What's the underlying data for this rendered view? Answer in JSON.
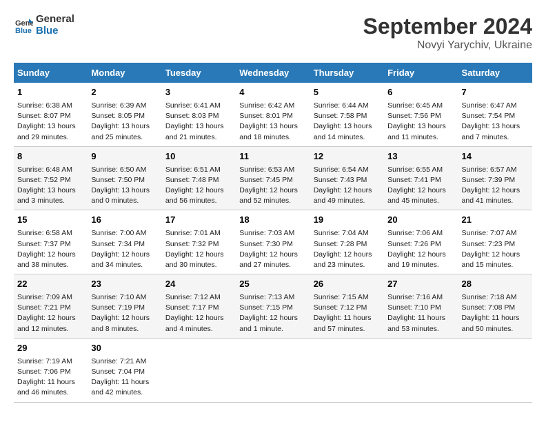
{
  "header": {
    "logo_line1": "General",
    "logo_line2": "Blue",
    "month": "September 2024",
    "location": "Novyi Yarychiv, Ukraine"
  },
  "days_of_week": [
    "Sunday",
    "Monday",
    "Tuesday",
    "Wednesday",
    "Thursday",
    "Friday",
    "Saturday"
  ],
  "weeks": [
    [
      {
        "day": "1",
        "info": "Sunrise: 6:38 AM\nSunset: 8:07 PM\nDaylight: 13 hours\nand 29 minutes."
      },
      {
        "day": "2",
        "info": "Sunrise: 6:39 AM\nSunset: 8:05 PM\nDaylight: 13 hours\nand 25 minutes."
      },
      {
        "day": "3",
        "info": "Sunrise: 6:41 AM\nSunset: 8:03 PM\nDaylight: 13 hours\nand 21 minutes."
      },
      {
        "day": "4",
        "info": "Sunrise: 6:42 AM\nSunset: 8:01 PM\nDaylight: 13 hours\nand 18 minutes."
      },
      {
        "day": "5",
        "info": "Sunrise: 6:44 AM\nSunset: 7:58 PM\nDaylight: 13 hours\nand 14 minutes."
      },
      {
        "day": "6",
        "info": "Sunrise: 6:45 AM\nSunset: 7:56 PM\nDaylight: 13 hours\nand 11 minutes."
      },
      {
        "day": "7",
        "info": "Sunrise: 6:47 AM\nSunset: 7:54 PM\nDaylight: 13 hours\nand 7 minutes."
      }
    ],
    [
      {
        "day": "8",
        "info": "Sunrise: 6:48 AM\nSunset: 7:52 PM\nDaylight: 13 hours\nand 3 minutes."
      },
      {
        "day": "9",
        "info": "Sunrise: 6:50 AM\nSunset: 7:50 PM\nDaylight: 13 hours\nand 0 minutes."
      },
      {
        "day": "10",
        "info": "Sunrise: 6:51 AM\nSunset: 7:48 PM\nDaylight: 12 hours\nand 56 minutes."
      },
      {
        "day": "11",
        "info": "Sunrise: 6:53 AM\nSunset: 7:45 PM\nDaylight: 12 hours\nand 52 minutes."
      },
      {
        "day": "12",
        "info": "Sunrise: 6:54 AM\nSunset: 7:43 PM\nDaylight: 12 hours\nand 49 minutes."
      },
      {
        "day": "13",
        "info": "Sunrise: 6:55 AM\nSunset: 7:41 PM\nDaylight: 12 hours\nand 45 minutes."
      },
      {
        "day": "14",
        "info": "Sunrise: 6:57 AM\nSunset: 7:39 PM\nDaylight: 12 hours\nand 41 minutes."
      }
    ],
    [
      {
        "day": "15",
        "info": "Sunrise: 6:58 AM\nSunset: 7:37 PM\nDaylight: 12 hours\nand 38 minutes."
      },
      {
        "day": "16",
        "info": "Sunrise: 7:00 AM\nSunset: 7:34 PM\nDaylight: 12 hours\nand 34 minutes."
      },
      {
        "day": "17",
        "info": "Sunrise: 7:01 AM\nSunset: 7:32 PM\nDaylight: 12 hours\nand 30 minutes."
      },
      {
        "day": "18",
        "info": "Sunrise: 7:03 AM\nSunset: 7:30 PM\nDaylight: 12 hours\nand 27 minutes."
      },
      {
        "day": "19",
        "info": "Sunrise: 7:04 AM\nSunset: 7:28 PM\nDaylight: 12 hours\nand 23 minutes."
      },
      {
        "day": "20",
        "info": "Sunrise: 7:06 AM\nSunset: 7:26 PM\nDaylight: 12 hours\nand 19 minutes."
      },
      {
        "day": "21",
        "info": "Sunrise: 7:07 AM\nSunset: 7:23 PM\nDaylight: 12 hours\nand 15 minutes."
      }
    ],
    [
      {
        "day": "22",
        "info": "Sunrise: 7:09 AM\nSunset: 7:21 PM\nDaylight: 12 hours\nand 12 minutes."
      },
      {
        "day": "23",
        "info": "Sunrise: 7:10 AM\nSunset: 7:19 PM\nDaylight: 12 hours\nand 8 minutes."
      },
      {
        "day": "24",
        "info": "Sunrise: 7:12 AM\nSunset: 7:17 PM\nDaylight: 12 hours\nand 4 minutes."
      },
      {
        "day": "25",
        "info": "Sunrise: 7:13 AM\nSunset: 7:15 PM\nDaylight: 12 hours\nand 1 minute."
      },
      {
        "day": "26",
        "info": "Sunrise: 7:15 AM\nSunset: 7:12 PM\nDaylight: 11 hours\nand 57 minutes."
      },
      {
        "day": "27",
        "info": "Sunrise: 7:16 AM\nSunset: 7:10 PM\nDaylight: 11 hours\nand 53 minutes."
      },
      {
        "day": "28",
        "info": "Sunrise: 7:18 AM\nSunset: 7:08 PM\nDaylight: 11 hours\nand 50 minutes."
      }
    ],
    [
      {
        "day": "29",
        "info": "Sunrise: 7:19 AM\nSunset: 7:06 PM\nDaylight: 11 hours\nand 46 minutes."
      },
      {
        "day": "30",
        "info": "Sunrise: 7:21 AM\nSunset: 7:04 PM\nDaylight: 11 hours\nand 42 minutes."
      },
      {
        "day": "",
        "info": ""
      },
      {
        "day": "",
        "info": ""
      },
      {
        "day": "",
        "info": ""
      },
      {
        "day": "",
        "info": ""
      },
      {
        "day": "",
        "info": ""
      }
    ]
  ]
}
